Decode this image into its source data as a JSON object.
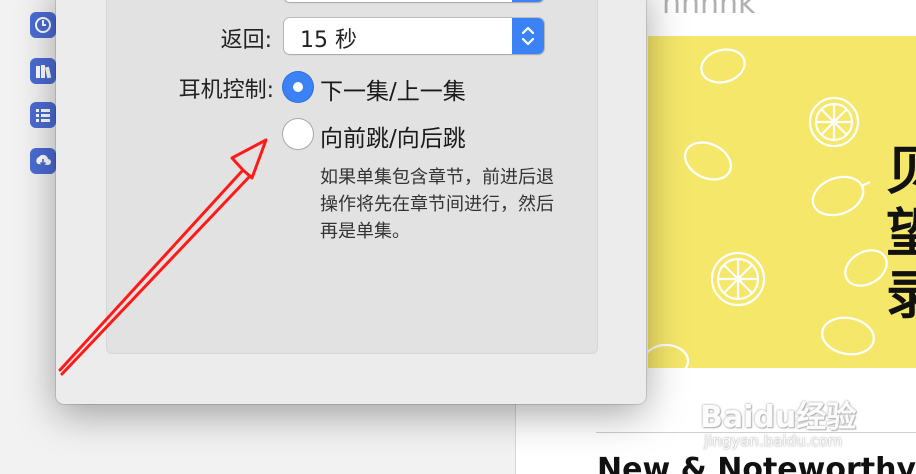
{
  "dialog": {
    "return_label": "返回:",
    "return_value": "15 秒",
    "headphone_label": "耳机控制:",
    "options": [
      {
        "label": "下一集/上一集",
        "selected": true
      },
      {
        "label": "向前跳/向后跳",
        "selected": false
      }
    ],
    "help_text": "如果单集包含章节，前进后退操作将先在章节间进行，然后再是单集。"
  },
  "background": {
    "header_fragment": "nnnnk",
    "poster_text": "贝望录",
    "bottom_title": "New & Noteworthy",
    "watermark": "Baidu经验",
    "watermark_sub": "jingyan.baidu.com"
  },
  "sidebar_icons": [
    "clock-icon",
    "library-icon",
    "list-icon",
    "download-icon"
  ],
  "colors": {
    "accent": "#3b82f6",
    "annotation": "#ff1a1a",
    "poster_bg": "#f5e76a"
  }
}
